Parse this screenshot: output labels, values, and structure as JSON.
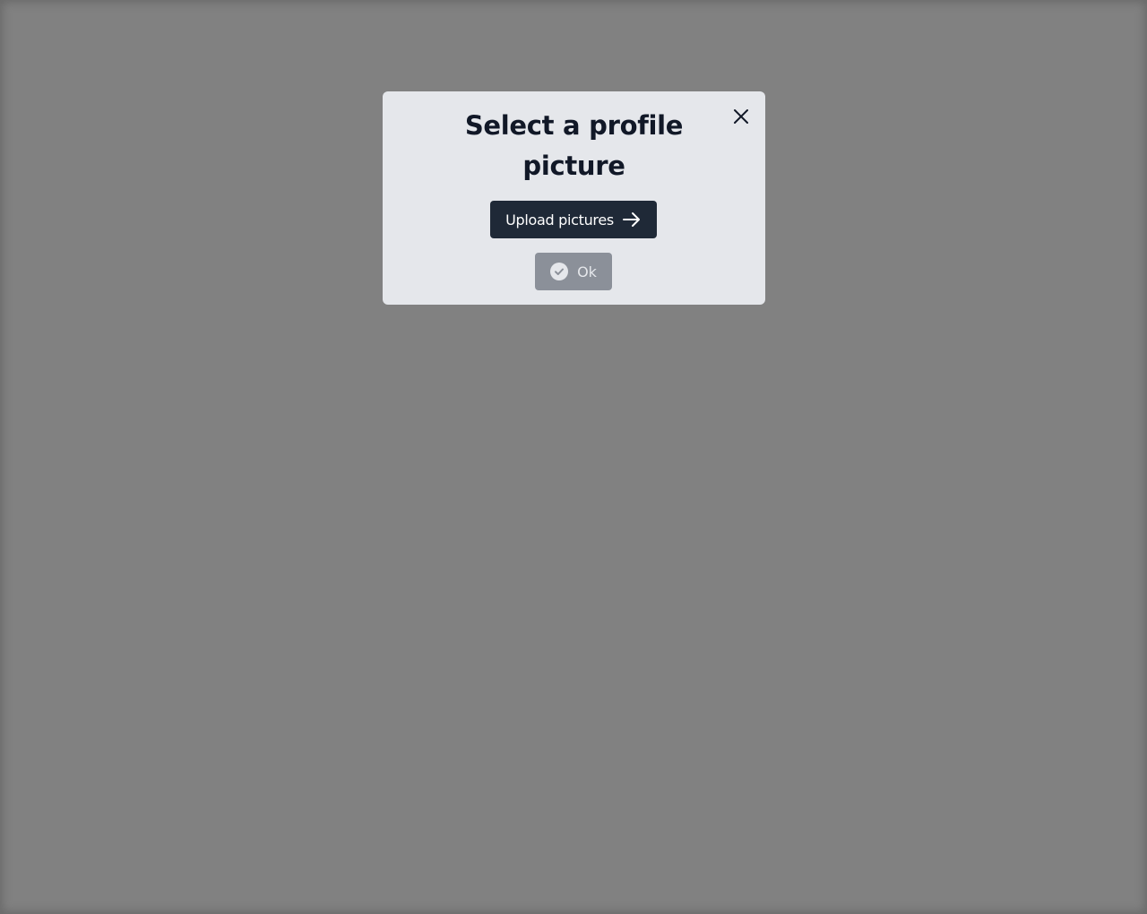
{
  "modal": {
    "title": "Select a profile picture",
    "close_icon": "close-icon",
    "upload_button": {
      "label": "Upload pictures",
      "icon": "arrow-right-icon"
    },
    "ok_button": {
      "label": "Ok",
      "icon": "check-circle-icon",
      "disabled": true
    }
  },
  "colors": {
    "overlay": "#818181",
    "modal_bg": "#e5e7eb",
    "title": "#111827",
    "primary_button": "#1f2937",
    "disabled_button": "#8b9099"
  }
}
